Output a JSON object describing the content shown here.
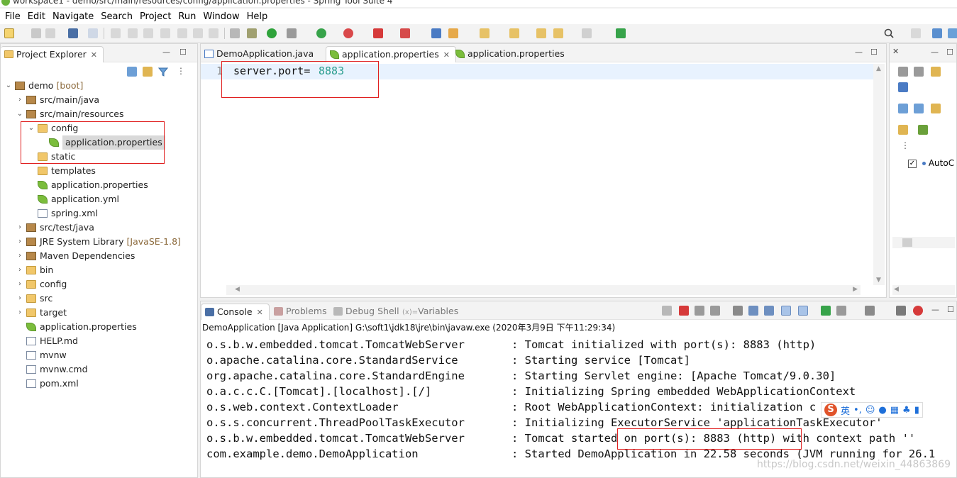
{
  "window": {
    "title": "workspace1 - demo/src/main/resources/config/application.properties - Spring Tool Suite 4"
  },
  "menu": [
    "File",
    "Edit",
    "Navigate",
    "Search",
    "Project",
    "Run",
    "Window",
    "Help"
  ],
  "project_explorer": {
    "tab_label": "Project Explorer",
    "close": "✕",
    "tree": [
      {
        "label": "demo",
        "suffix": "[boot]",
        "depth": 0,
        "twisty": "expanded",
        "icon": "project-icon"
      },
      {
        "label": "src/main/java",
        "depth": 1,
        "twisty": "collapsed",
        "icon": "source-folder-icon"
      },
      {
        "label": "src/main/resources",
        "depth": 1,
        "twisty": "expanded",
        "icon": "source-folder-icon"
      },
      {
        "label": "config",
        "depth": 2,
        "twisty": "expanded",
        "icon": "folder-open-icon"
      },
      {
        "label": "application.properties",
        "depth": 3,
        "twisty": "",
        "icon": "spring-leaf-icon",
        "selected": true
      },
      {
        "label": "static",
        "depth": 2,
        "twisty": "",
        "icon": "folder-open-icon"
      },
      {
        "label": "templates",
        "depth": 2,
        "twisty": "",
        "icon": "folder-open-icon"
      },
      {
        "label": "application.properties",
        "depth": 2,
        "twisty": "",
        "icon": "spring-leaf-icon"
      },
      {
        "label": "application.yml",
        "depth": 2,
        "twisty": "",
        "icon": "spring-leaf-icon"
      },
      {
        "label": "spring.xml",
        "depth": 2,
        "twisty": "",
        "icon": "xml-file-icon"
      },
      {
        "label": "src/test/java",
        "depth": 1,
        "twisty": "collapsed",
        "icon": "source-folder-icon"
      },
      {
        "label": "JRE System Library",
        "suffix": "[JavaSE-1.8]",
        "depth": 1,
        "twisty": "collapsed",
        "icon": "library-icon"
      },
      {
        "label": "Maven Dependencies",
        "depth": 1,
        "twisty": "collapsed",
        "icon": "library-icon"
      },
      {
        "label": "bin",
        "depth": 1,
        "twisty": "collapsed",
        "icon": "folder-icon"
      },
      {
        "label": "config",
        "depth": 1,
        "twisty": "collapsed",
        "icon": "folder-icon"
      },
      {
        "label": "src",
        "depth": 1,
        "twisty": "collapsed",
        "icon": "folder-icon"
      },
      {
        "label": "target",
        "depth": 1,
        "twisty": "collapsed",
        "icon": "folder-icon"
      },
      {
        "label": "application.properties",
        "depth": 1,
        "twisty": "",
        "icon": "spring-leaf-icon"
      },
      {
        "label": "HELP.md",
        "depth": 1,
        "twisty": "",
        "icon": "text-file-icon"
      },
      {
        "label": "mvnw",
        "depth": 1,
        "twisty": "",
        "icon": "text-file-icon"
      },
      {
        "label": "mvnw.cmd",
        "depth": 1,
        "twisty": "",
        "icon": "cmd-file-icon"
      },
      {
        "label": "pom.xml",
        "depth": 1,
        "twisty": "",
        "icon": "maven-pom-icon"
      }
    ]
  },
  "editor": {
    "tabs": [
      {
        "label": "DemoApplication.java",
        "active": false,
        "icon": "java-file-icon"
      },
      {
        "label": "application.properties",
        "active": true,
        "icon": "spring-leaf-icon",
        "close": "✕"
      },
      {
        "label": "application.properties",
        "active": false,
        "icon": "spring-leaf-icon"
      }
    ],
    "line_number": "1",
    "code_key": "server.port=",
    "code_value": "8883"
  },
  "outline": {
    "item_label": "AutoC"
  },
  "console": {
    "tabs": [
      "Console",
      "Problems",
      "Debug Shell",
      "Variables"
    ],
    "variables_prefix": "(x)=",
    "process": "DemoApplication [Java Application] G:\\soft1\\jdk18\\jre\\bin\\javaw.exe (2020年3月9日 下午11:29:34)",
    "lines": [
      {
        "logger": "o.s.b.w.embedded.tomcat.TomcatWebServer",
        "msg": ": Tomcat initialized with port(s): 8883 (http)"
      },
      {
        "logger": "o.apache.catalina.core.StandardService",
        "msg": ": Starting service [Tomcat]"
      },
      {
        "logger": "org.apache.catalina.core.StandardEngine",
        "msg": ": Starting Servlet engine: [Apache Tomcat/9.0.30]"
      },
      {
        "logger": "o.a.c.c.C.[Tomcat].[localhost].[/]",
        "msg": ": Initializing Spring embedded WebApplicationContext"
      },
      {
        "logger": "o.s.web.context.ContextLoader",
        "msg": ": Root WebApplicationContext: initialization c"
      },
      {
        "logger": "o.s.s.concurrent.ThreadPoolTaskExecutor",
        "msg": ": Initializing ExecutorService 'applicationTaskExecutor'"
      },
      {
        "logger": "o.s.b.w.embedded.tomcat.TomcatWebServer",
        "msg": ": Tomcat started on port(s): 8883 (http) with context path ''"
      },
      {
        "logger": "com.example.demo.DemoApplication",
        "msg": ": Started DemoApplication in 22.58 seconds (JVM running for 26.1"
      }
    ],
    "watermark": "https://blog.csdn.net/weixin_44863869"
  },
  "ime": {
    "label": "英",
    "extra": "•,"
  },
  "colors": {
    "accent_red": "#e02020",
    "leaf_green": "#7bbd3c",
    "value_teal": "#2a9d8f",
    "code_bg": "#e8f2fe"
  }
}
